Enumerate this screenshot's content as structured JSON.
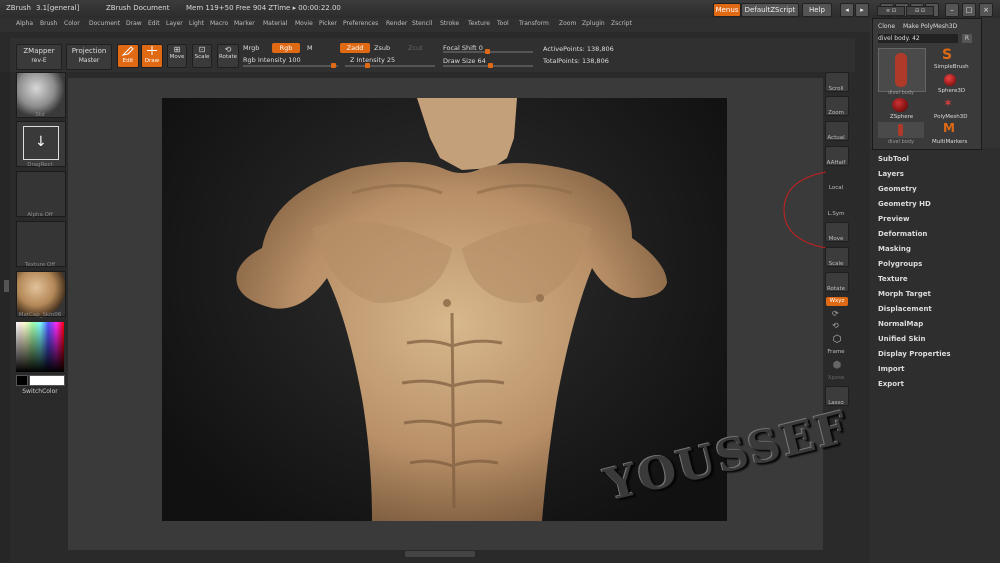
{
  "titlebar": {
    "app": "ZBrush",
    "version": "3.1[general]",
    "document": "ZBrush Document",
    "mem": "Mem 119+50 Free 904 ZTime ▸ 00:00:22.00",
    "menus_btn": "Menus",
    "script_btn": "DefaultZScript",
    "help_btn": "Help"
  },
  "menubar": [
    "Alpha",
    "Brush",
    "Color",
    "Document",
    "Draw",
    "Edit",
    "Layer",
    "Light",
    "Macro",
    "Marker",
    "Material",
    "Movie",
    "Picker",
    "Preferences",
    "Render",
    "Stencil",
    "Stroke",
    "Texture",
    "Tool",
    "Transform",
    "Zoom",
    "Zplugin",
    "Zscript"
  ],
  "shelf": {
    "zmapper": "ZMapper",
    "zmapper_sub": "rev-E",
    "projection": "Projection",
    "projection_sub": "Master",
    "edit": "Edit",
    "draw": "Draw",
    "move": "Move",
    "scale": "Scale",
    "rotate": "Rotate",
    "mrgb": "Mrgb",
    "rgb": "Rgb",
    "m": "M",
    "rgb_intensity": "Rgb Intensity 100",
    "zadd": "Zadd",
    "zsub": "Zsub",
    "zcut": "Zcut",
    "z_intensity": "Z Intensity 25",
    "focal_shift": "Focal Shift 0",
    "draw_size": "Draw Size 64",
    "active_points": "ActivePoints: 138,806",
    "total_points": "TotalPoints: 138,806"
  },
  "lefttray": {
    "brush": "Std",
    "stroke": "DragRect",
    "alpha": "Alpha Off",
    "texture": "Texture Off",
    "material": "MatCap_Skin06",
    "switchcolor": "SwitchColor"
  },
  "rightshelf": [
    "Scroll",
    "Zoom",
    "Actual",
    "AAHalf",
    "Local",
    "L.Sym",
    "Move",
    "Scale",
    "Rotate",
    "PolyF",
    "Frame",
    "Xpose",
    "Lasso"
  ],
  "rightshelf_xyz": "Wxyz",
  "toolpanel": {
    "clone": "Clone",
    "make_polymesh": "Make PolyMesh3D",
    "current_tool": "divel body. 42",
    "r_btn": "R",
    "tools": [
      "divel body",
      "SimpleBrush",
      "ZSphere",
      "Sphere3D",
      "divel body",
      "PolyMesh3D",
      "divel body",
      "MultiMarkers"
    ]
  },
  "menu_items": [
    "SubTool",
    "Layers",
    "Geometry",
    "Geometry HD",
    "Preview",
    "Deformation",
    "Masking",
    "Polygroups",
    "Texture",
    "Morph Target",
    "Displacement",
    "NormalMap",
    "Unified Skin",
    "Display Properties",
    "Import",
    "Export"
  ],
  "watermark": "YOUSSEF",
  "colors": {
    "accent": "#e06a14",
    "skin": "#c9a57a"
  }
}
